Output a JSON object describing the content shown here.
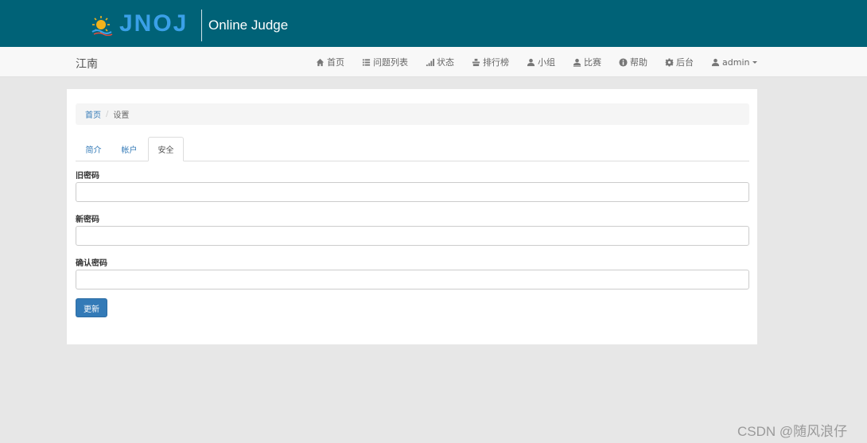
{
  "header": {
    "logo_text": "JNOJ",
    "site_title": "Online Judge",
    "background": "#006277"
  },
  "navbar": {
    "brand": "江南",
    "items": [
      {
        "label": "首页",
        "icon": "home-icon"
      },
      {
        "label": "问题列表",
        "icon": "list-icon"
      },
      {
        "label": "状态",
        "icon": "signal-icon"
      },
      {
        "label": "排行榜",
        "icon": "podium-icon"
      },
      {
        "label": "小组",
        "icon": "user-icon"
      },
      {
        "label": "比赛",
        "icon": "user-medal-icon"
      },
      {
        "label": "帮助",
        "icon": "info-icon"
      },
      {
        "label": "后台",
        "icon": "gear-icon"
      },
      {
        "label": "admin",
        "icon": "user-icon"
      }
    ]
  },
  "breadcrumb": {
    "home": "首页",
    "separator": "/",
    "current": "设置"
  },
  "tabs": [
    {
      "label": "简介"
    },
    {
      "label": "帐户"
    },
    {
      "label": "安全",
      "active": true
    }
  ],
  "form": {
    "old_password_label": "旧密码",
    "new_password_label": "新密码",
    "confirm_password_label": "确认密码",
    "old_password_value": "",
    "new_password_value": "",
    "confirm_password_value": "",
    "submit_label": "更新"
  },
  "watermark": "CSDN @随风浪仔",
  "colors": {
    "accent": "#337ab7",
    "page_bg": "#e7e7e7"
  }
}
